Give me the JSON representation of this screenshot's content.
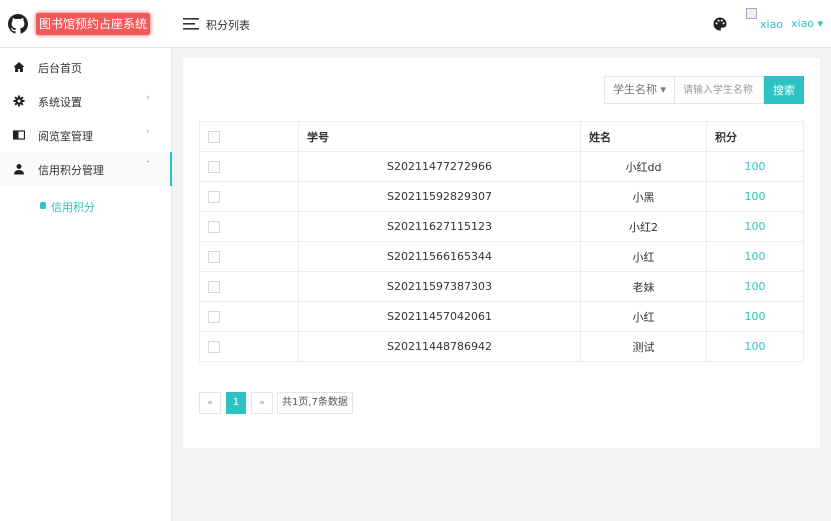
{
  "app": {
    "title": "图书馆预约占座系统"
  },
  "header": {
    "page_title": "积分列表",
    "avatar_alt": "xiao",
    "user_name": "xiao ▾"
  },
  "sidebar": {
    "items": [
      {
        "label": "后台首页",
        "icon": "home-icon",
        "caret": ""
      },
      {
        "label": "系统设置",
        "icon": "gear-icon",
        "caret": "›"
      },
      {
        "label": "阅览室管理",
        "icon": "book-icon",
        "caret": "›"
      },
      {
        "label": "信用积分管理",
        "icon": "user-icon",
        "caret": "ˇ"
      }
    ],
    "sub_items": [
      {
        "label": "信用积分"
      }
    ]
  },
  "search": {
    "select_label": "学生名称 ▾",
    "placeholder": "请输入学生名称",
    "button": "搜索"
  },
  "table": {
    "columns": [
      "学号",
      "姓名",
      "积分"
    ],
    "rows": [
      [
        "S20211477272966",
        "小红dd",
        "100"
      ],
      [
        "S20211592829307",
        "小黑",
        "100"
      ],
      [
        "S20211627115123",
        "小红2",
        "100"
      ],
      [
        "S20211566165344",
        "小红",
        "100"
      ],
      [
        "S20211597387303",
        "老妹",
        "100"
      ],
      [
        "S20211457042061",
        "小红",
        "100"
      ],
      [
        "S20211448786942",
        "测试",
        "100"
      ]
    ]
  },
  "pagination": {
    "prev": "«",
    "current": "1",
    "next": "»",
    "info": "共1页,7条数据"
  },
  "colors": {
    "accent": "#2ec3c3",
    "brand_bg": "#f25a5a"
  }
}
